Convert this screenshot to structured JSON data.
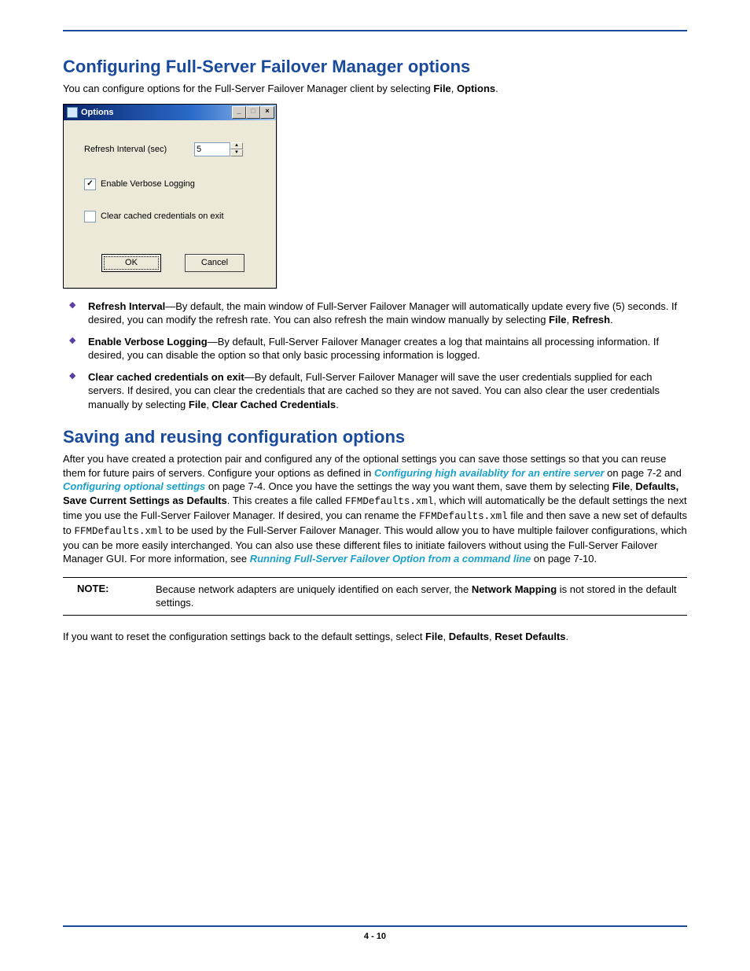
{
  "heading1": "Configuring Full-Server Failover Manager options",
  "intro1_a": "You can configure options for the Full-Server Failover Manager client by selecting ",
  "intro1_b": "File",
  "intro1_c": ", ",
  "intro1_d": "Options",
  "intro1_e": ".",
  "dialog": {
    "title": "Options",
    "refresh_label": "Refresh Interval (sec)",
    "refresh_value": "5",
    "verbose_label": "Enable Verbose Logging",
    "verbose_checked": true,
    "clear_label": "Clear cached credentials on exit",
    "clear_checked": false,
    "ok": "OK",
    "cancel": "Cancel"
  },
  "bullets": [
    {
      "term": "Refresh Interval",
      "dash": "—",
      "text_a": "By default, the main window of Full-Server Failover Manager will automatically update every five (5) seconds. If desired, you can modify the refresh rate. You can also refresh the main window manually by selecting ",
      "b1": "File",
      "c1": ", ",
      "b2": "Refresh",
      "c2": "."
    },
    {
      "term": "Enable Verbose Logging",
      "dash": "—",
      "text_a": "By default, Full-Server Failover Manager creates a log that maintains all processing information. If desired, you can disable the option so that only basic processing information is logged."
    },
    {
      "term": "Clear cached credentials on exit",
      "dash": "—",
      "text_a": "By default, Full-Server Failover Manager will save the user credentials supplied for each servers. If desired, you can clear the credentials that are cached so they are not saved. You can also clear the user credentials manually by selecting ",
      "b1": "File",
      "c1": ", ",
      "b2": "Clear Cached Credentials",
      "c2": "."
    }
  ],
  "heading2": "Saving and reusing configuration options",
  "para2": {
    "t1": "After you have created a protection pair and configured any of the optional settings you can save those settings so that you can reuse them for future pairs of servers. Configure your options as defined in ",
    "link1": "Configuring high availablity for an entire server",
    "t2": " on page 7-2  and ",
    "link2": "Configuring optional settings",
    "t3": " on page 7-4. Once you have the settings the way you want them, save them by selecting ",
    "b1": "File",
    "t4": ", ",
    "b2": "Defaults, Save Current Settings as Defaults",
    "t5": ". This creates a file called ",
    "code1": "FFMDefaults.xml",
    "t6": ", which will automatically be the default settings the next time you use the Full-Server Failover Manager. If desired, you can rename the ",
    "code2": "FFMDefaults.xml",
    "t7": " file and then save a new set of defaults to ",
    "code3": "FFMDefaults.xml",
    "t8": " to be used by the Full-Server Failover Manager. This would allow you to have multiple failover configurations, which you can be more easily interchanged. You can also use these different files to initiate failovers without using the Full-Server Failover Manager GUI. For more information, see ",
    "link3": "Running Full-Server Failover Option from a command line",
    "t9": " on page 7-10."
  },
  "note": {
    "label": "NOTE:",
    "t1": "Because network adapters are uniquely identified on each server, the ",
    "b1": "Network Mapping",
    "t2": " is not stored in the default settings."
  },
  "para3": {
    "t1": "If you want to reset the configuration settings back to the default settings, select ",
    "b1": "File",
    "c1": ", ",
    "b2": "Defaults",
    "c2": ", ",
    "b3": "Reset Defaults",
    "c3": "."
  },
  "footer": "4 - 10"
}
